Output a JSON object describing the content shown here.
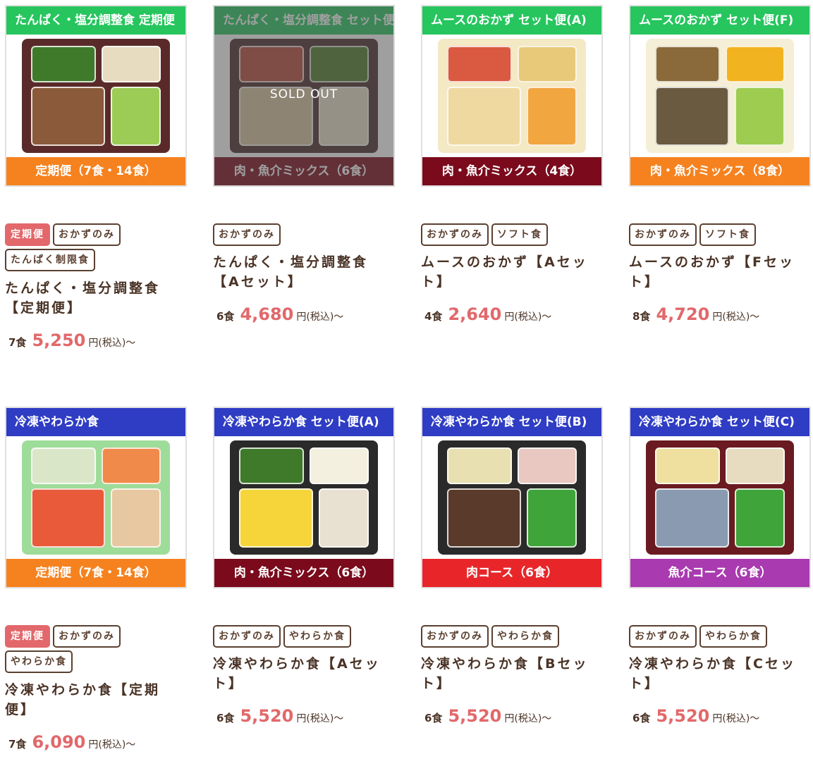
{
  "products": [
    {
      "image_top_banner": "たんぱく・塩分調整食 定期便",
      "image_bottom_banner": "定期便（7食・14食）",
      "top_color": "#26c55e",
      "bottom_color": "#f5821f",
      "sold_out": false,
      "tags": [
        {
          "label": "定期便",
          "style": "red"
        },
        {
          "label": "おかずのみ",
          "style": "outline"
        },
        {
          "label": "たんぱく制限食",
          "style": "outline"
        }
      ],
      "title": "たんぱく・塩分調整食【定期便】",
      "count": "7食",
      "price": "5,250",
      "unit": "円(税込)〜"
    },
    {
      "image_top_banner": "たんぱく・塩分調整食 セット便(A)",
      "image_bottom_banner": "肉・魚介ミックス（6食）",
      "top_color": "#26c55e",
      "bottom_color": "#7a0a1c",
      "sold_out": true,
      "sold_out_label": "SOLD OUT",
      "tags": [
        {
          "label": "おかずのみ",
          "style": "outline"
        }
      ],
      "title": "たんぱく・塩分調整食【Aセット】",
      "count": "6食",
      "price": "4,680",
      "unit": "円(税込)〜"
    },
    {
      "image_top_banner": "ムースのおかず セット便(A)",
      "image_bottom_banner": "肉・魚介ミックス（4食）",
      "top_color": "#26c55e",
      "bottom_color": "#7a0a1c",
      "sold_out": false,
      "tags": [
        {
          "label": "おかずのみ",
          "style": "outline"
        },
        {
          "label": "ソフト食",
          "style": "outline"
        }
      ],
      "title": "ムースのおかず【Aセット】",
      "count": "4食",
      "price": "2,640",
      "unit": "円(税込)〜"
    },
    {
      "image_top_banner": "ムースのおかず セット便(F)",
      "image_bottom_banner": "肉・魚介ミックス（8食）",
      "top_color": "#26c55e",
      "bottom_color": "#f5821f",
      "sold_out": false,
      "tags": [
        {
          "label": "おかずのみ",
          "style": "outline"
        },
        {
          "label": "ソフト食",
          "style": "outline"
        }
      ],
      "title": "ムースのおかず【Fセット】",
      "count": "8食",
      "price": "4,720",
      "unit": "円(税込)〜"
    },
    {
      "image_top_banner": "冷凍やわらか食",
      "image_bottom_banner": "定期便（7食・14食）",
      "top_color": "#2f3cc4",
      "bottom_color": "#f5821f",
      "sold_out": false,
      "tags": [
        {
          "label": "定期便",
          "style": "red"
        },
        {
          "label": "おかずのみ",
          "style": "outline"
        },
        {
          "label": "やわらか食",
          "style": "outline"
        }
      ],
      "title": "冷凍やわらか食【定期便】",
      "count": "7食",
      "price": "6,090",
      "unit": "円(税込)〜"
    },
    {
      "image_top_banner": "冷凍やわらか食 セット便(A)",
      "image_bottom_banner": "肉・魚介ミックス（6食）",
      "top_color": "#2f3cc4",
      "bottom_color": "#7a0a1c",
      "sold_out": false,
      "tags": [
        {
          "label": "おかずのみ",
          "style": "outline"
        },
        {
          "label": "やわらか食",
          "style": "outline"
        }
      ],
      "title": "冷凍やわらか食【Aセット】",
      "count": "6食",
      "price": "5,520",
      "unit": "円(税込)〜"
    },
    {
      "image_top_banner": "冷凍やわらか食 セット便(B)",
      "image_bottom_banner": "肉コース（6食）",
      "top_color": "#2f3cc4",
      "bottom_color": "#e8262a",
      "sold_out": false,
      "tags": [
        {
          "label": "おかずのみ",
          "style": "outline"
        },
        {
          "label": "やわらか食",
          "style": "outline"
        }
      ],
      "title": "冷凍やわらか食【Bセット】",
      "count": "6食",
      "price": "5,520",
      "unit": "円(税込)〜"
    },
    {
      "image_top_banner": "冷凍やわらか食 セット便(C)",
      "image_bottom_banner": "魚介コース（6食）",
      "top_color": "#2f3cc4",
      "bottom_color": "#a93ab0",
      "sold_out": false,
      "tags": [
        {
          "label": "おかずのみ",
          "style": "outline"
        },
        {
          "label": "やわらか食",
          "style": "outline"
        }
      ],
      "title": "冷凍やわらか食【Cセット】",
      "count": "6食",
      "price": "5,520",
      "unit": "円(税込)〜"
    }
  ],
  "colors": {
    "accent_price": "#e2686b",
    "text": "#4a3326",
    "tag_border": "#5b4030"
  }
}
